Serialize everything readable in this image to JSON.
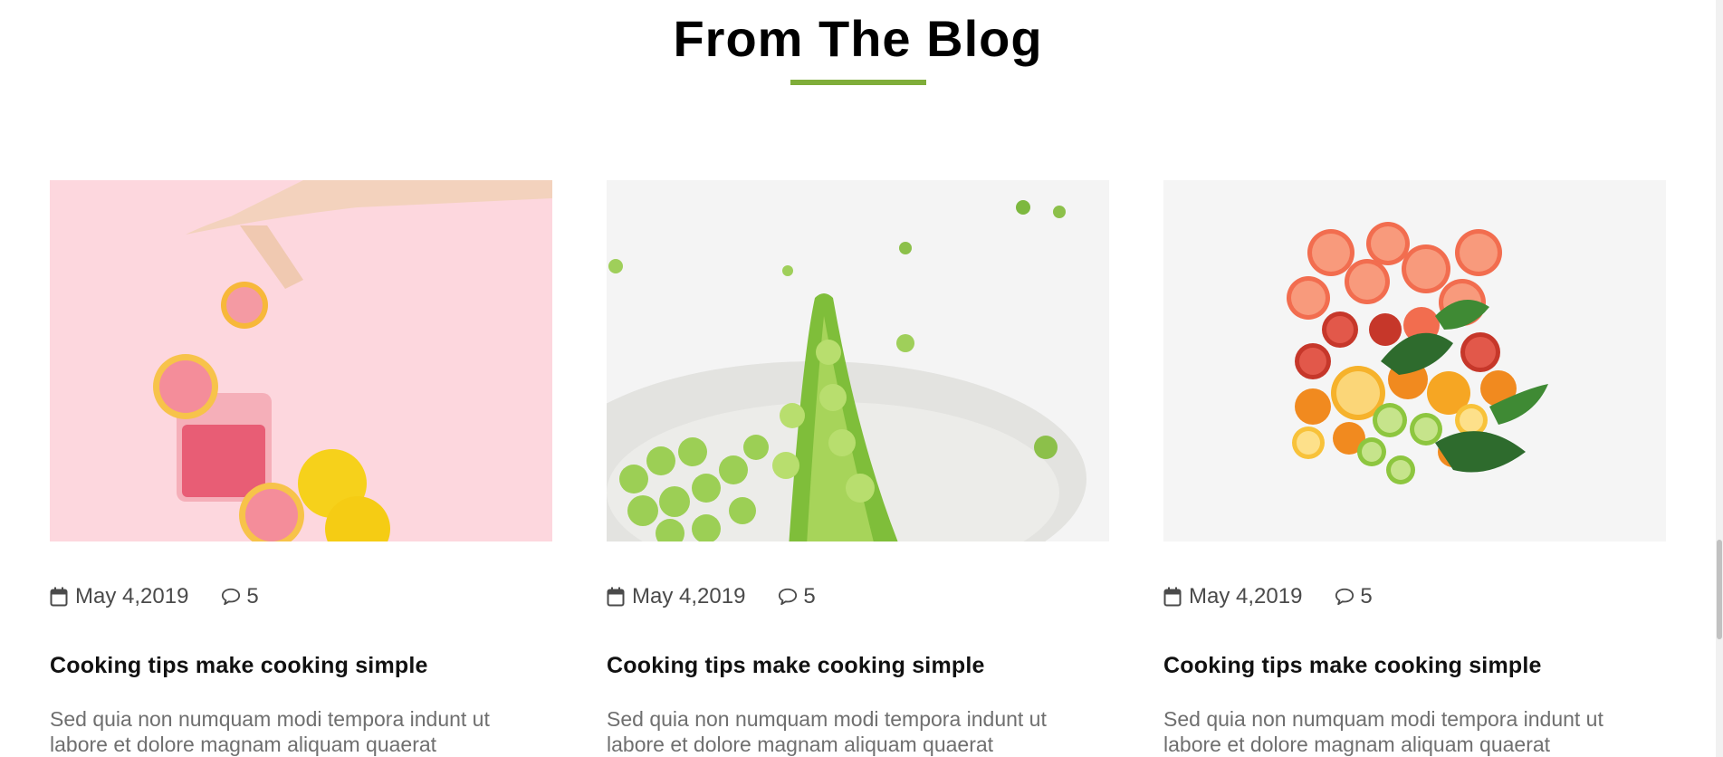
{
  "blog": {
    "title": "From The Blog",
    "accent_color": "#7fad39",
    "posts": [
      {
        "image": "grapefruit-drink-image",
        "date": "May 4,2019",
        "comments": "5",
        "title": "Cooking tips make cooking simple",
        "excerpt": "Sed quia non numquam modi tempora indunt ut labore et dolore magnam aliquam quaerat"
      },
      {
        "image": "green-peas-image",
        "date": "May 4,2019",
        "comments": "5",
        "title": "Cooking tips make cooking simple",
        "excerpt": "Sed quia non numquam modi tempora indunt ut labore et dolore magnam aliquam quaerat"
      },
      {
        "image": "citrus-slices-image",
        "date": "May 4,2019",
        "comments": "5",
        "title": "Cooking tips make cooking simple",
        "excerpt": "Sed quia non numquam modi tempora indunt ut labore et dolore magnam aliquam quaerat"
      }
    ]
  },
  "icons": {
    "date": "calendar-icon",
    "comments": "comment-icon"
  }
}
